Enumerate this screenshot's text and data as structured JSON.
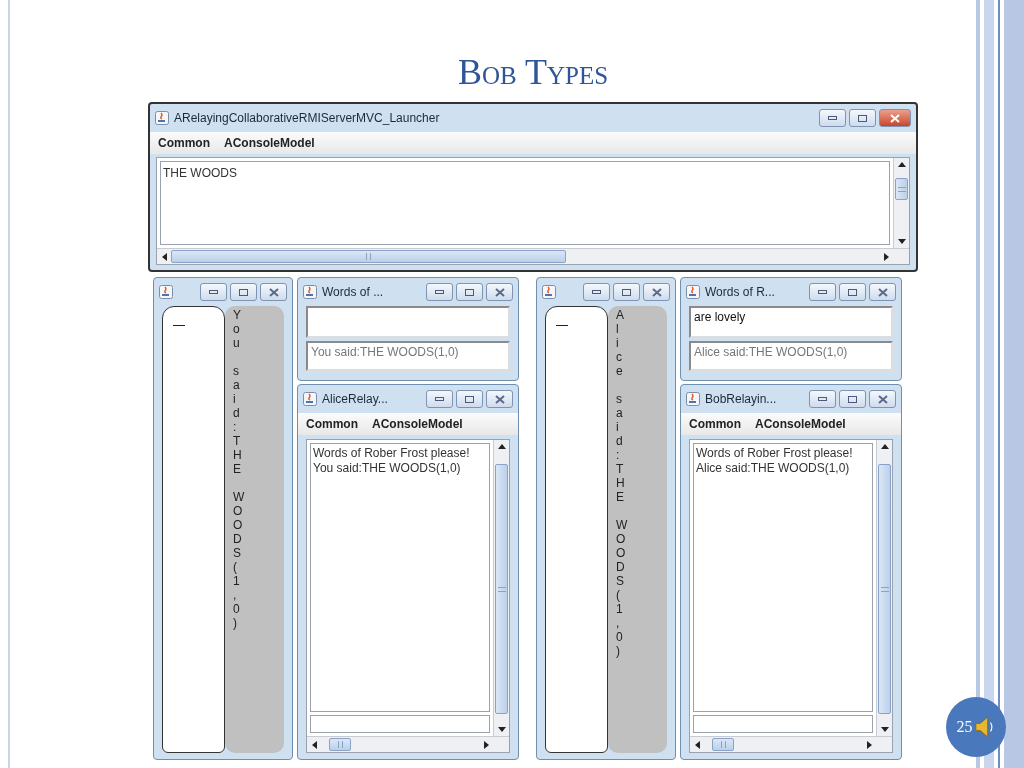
{
  "slide": {
    "title": "Bob Types",
    "page_number": "25"
  },
  "main_window": {
    "title": "ARelayingCollaborativeRMIServerMVC_Launcher",
    "menu": [
      "Common",
      "AConsoleModel"
    ],
    "text": "THE WOODS"
  },
  "groups": [
    {
      "small_window": {
        "vertical_text": "You said:THE WOODS(1,0)"
      },
      "words_window": {
        "title": "Words of ...",
        "output_text": "You said:THE WOODS(1,0)"
      },
      "relay_window": {
        "title": "AliceRelay...",
        "menu": [
          "Common",
          "AConsoleModel"
        ],
        "lines": [
          "Words of Rober Frost please!",
          "You said:THE WOODS(1,0)"
        ]
      }
    },
    {
      "small_window": {
        "vertical_text": "Alice said:THE WOODS(1,0)"
      },
      "words_window": {
        "title": "Words of R...",
        "input_value": "are lovely",
        "output_text": "Alice said:THE WOODS(1,0)"
      },
      "relay_window": {
        "title": "BobRelayin...",
        "menu": [
          "Common",
          "AConsoleModel"
        ],
        "lines": [
          "Words of Rober Frost please!",
          "Alice said:THE WOODS(1,0)"
        ]
      }
    }
  ]
}
